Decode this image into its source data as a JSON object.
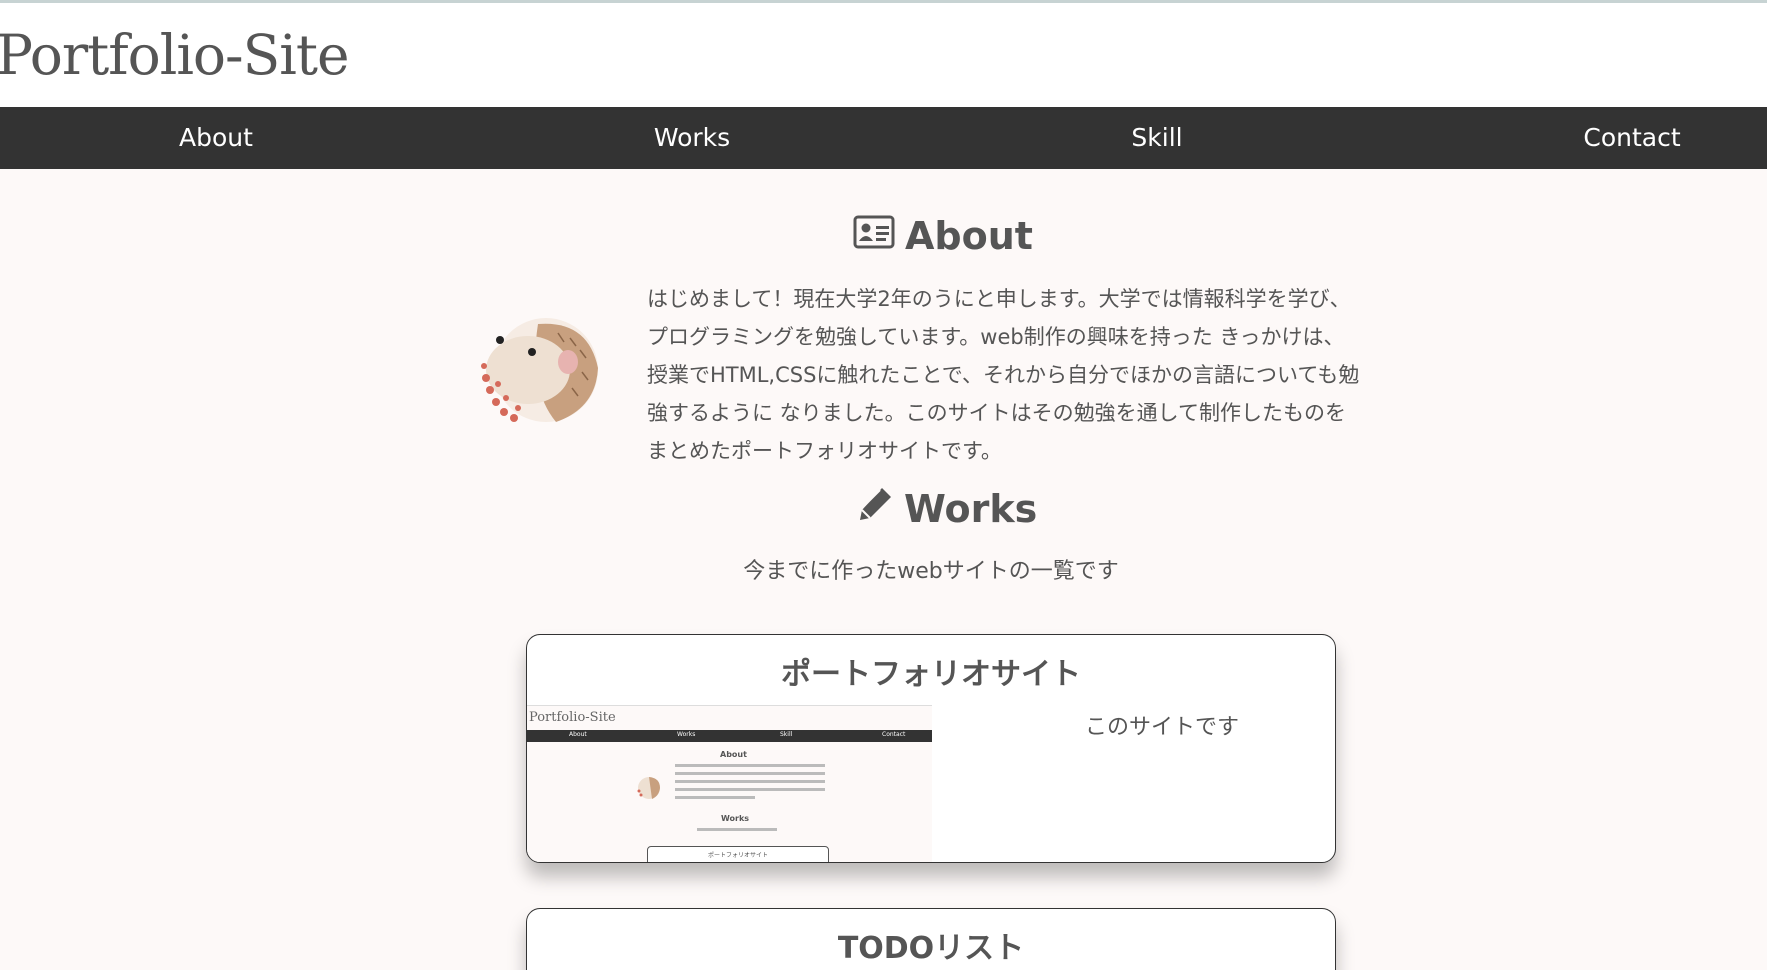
{
  "header": {
    "site_title": "Portfolio-Site"
  },
  "nav": {
    "items": [
      {
        "label": "About"
      },
      {
        "label": "Works"
      },
      {
        "label": "Skill"
      },
      {
        "label": "Contact"
      }
    ]
  },
  "about": {
    "heading": "About",
    "icon": "id-card-icon",
    "lines": [
      "はじめまして！現在大学2年のうにと申します。大学では情報科学を学び、",
      "プログラミングを勉強しています。web制作の興味を持った きっかけは、",
      "授業でHTML,CSSに触れたことで、それから自分でほかの言語についても勉",
      "強するように なりました。このサイトはその勉強を通して制作したものを",
      "まとめたポートフォリオサイトです。"
    ]
  },
  "works": {
    "heading": "Works",
    "icon": "pen-icon",
    "lead": "今までに作ったwebサイトの一覧です",
    "cards": [
      {
        "title": "ポートフォリオサイト",
        "description": "このサイトです",
        "thumbnail": {
          "site_title": "Portfolio-Site",
          "nav": [
            "About",
            "Works",
            "Skill",
            "Contact"
          ],
          "about_heading": "About",
          "works_heading": "Works",
          "card_title": "ポートフォリオサイト"
        }
      },
      {
        "title": "TODOリスト"
      }
    ]
  },
  "colors": {
    "background": "#fdf9f8",
    "nav_background": "#333333",
    "text": "#555555"
  }
}
